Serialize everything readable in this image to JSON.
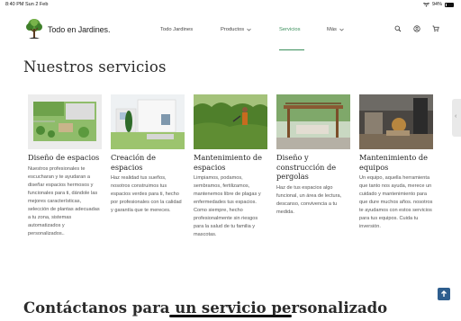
{
  "statusbar": {
    "time": "8:40 PM  Sun 2 Feb",
    "battery": "94%"
  },
  "site": {
    "name": "Todo en Jardines."
  },
  "nav": [
    {
      "label": "Todo Jardines",
      "has_caret": false,
      "active": false
    },
    {
      "label": "Productos",
      "has_caret": true,
      "active": false
    },
    {
      "label": "Servicios",
      "has_caret": false,
      "active": true
    },
    {
      "label": "Más",
      "has_caret": true,
      "active": false
    }
  ],
  "section_title": "Nuestros servicios",
  "cards": [
    {
      "title": "Diseño de espacios",
      "text": "Nuestros profesionales te escucharan y te ayudaran a diseñar espacios hermosos y funcionales para ti, dándole las mejores características, selección de plantas adecuadas a tu zona, sistemas automatizados y personalizados.."
    },
    {
      "title": "Creación de espacios",
      "text": "Haz realidad tus sueños, nosotros construimos tus espacios verdes para ti, hecho por profesionales con la calidad y garantía que te mereces."
    },
    {
      "title": "Mantenimiento de espacios",
      "text": "Limpiamos, podamos, sembramos, fertilizamos, mantenemos libre de plagas y enfermedades tus espacios. Como siempre, hecho profesionalmente sin riesgos para la salud de tu familia y mascotas."
    },
    {
      "title": "Diseño y construcción de pergolas",
      "text": "Haz de tus espacios algo funcional, un área de lectura, descanso, convivencia a tu medida."
    },
    {
      "title": "Mantenimiento de equipos",
      "text": "Un equipo, aquella herramienta que tanto nos ayuda, merece un cuidado y mantenimiento para que dure muchos años. nosotros te ayudamos con estos servicios para tus equipos. Cuida tu inversión."
    }
  ],
  "contact_title": "Contáctanos para un servicio personalizado",
  "icons": [
    "search-icon",
    "user-icon",
    "cart-icon",
    "scroll-top-icon",
    "wifi-icon",
    "battery-icon"
  ],
  "colors": {
    "accent": "#3a8f5b",
    "scroll_button": "#2e5e8e"
  }
}
